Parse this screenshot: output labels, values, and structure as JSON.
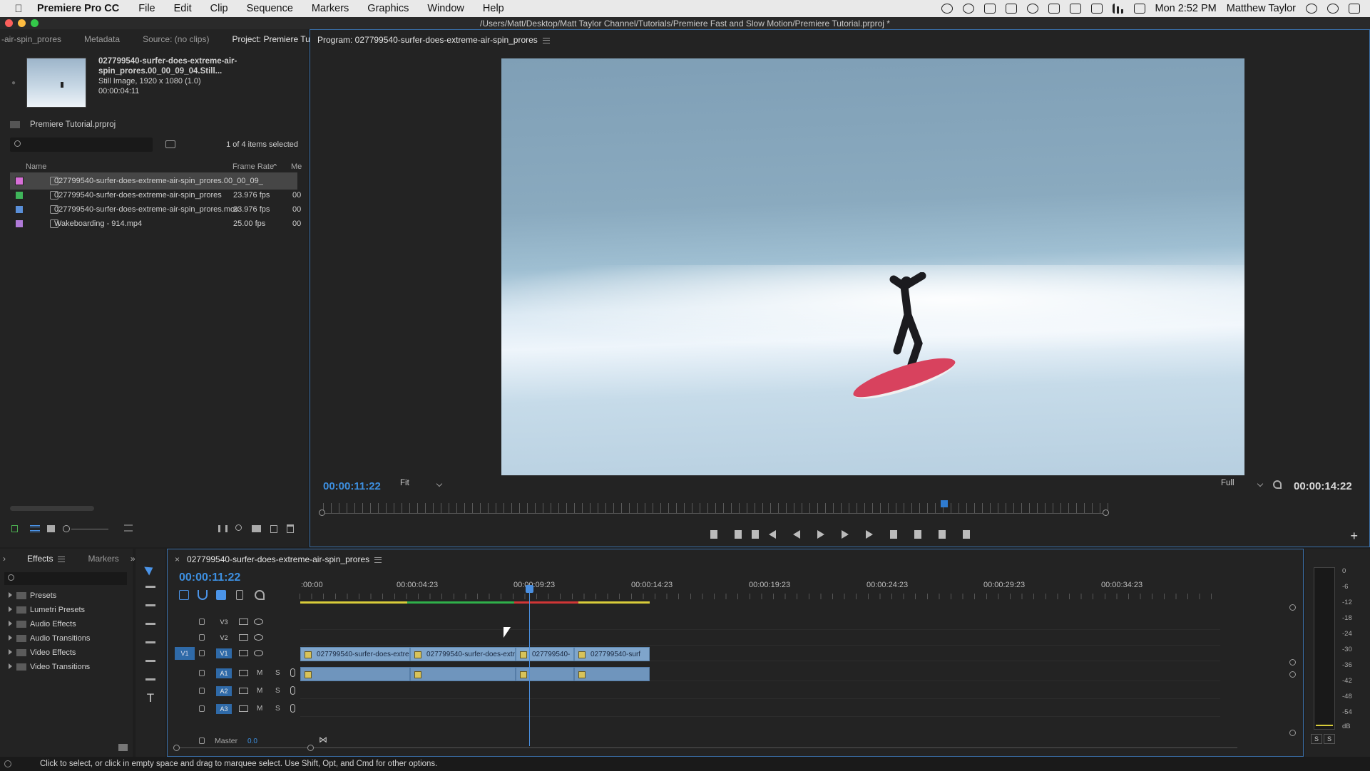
{
  "menubar": {
    "app_name": "Premiere Pro CC",
    "items": [
      "File",
      "Edit",
      "Clip",
      "Sequence",
      "Markers",
      "Graphics",
      "Window",
      "Help"
    ],
    "clock": "Mon 2:52 PM",
    "user": "Matthew Taylor"
  },
  "window": {
    "title": "/Users/Matt/Desktop/Matt Taylor Channel/Tutorials/Premiere Fast and Slow Motion/Premiere Tutorial.prproj *"
  },
  "project_panel": {
    "tabs": [
      "-air-spin_prores",
      "Metadata",
      "Source: (no clips)",
      "Project: Premiere Tutorial"
    ],
    "active_tab": "Project: Premiere Tutorial",
    "preview": {
      "filename": "027799540-surfer-does-extreme-air-spin_prores.00_00_09_04.Still...",
      "description": "Still Image, 1920 x 1080 (1.0)",
      "duration": "00:00:04:11"
    },
    "project_file": "Premiere Tutorial.prproj",
    "search_placeholder": "",
    "selection_count": "1 of 4 items selected",
    "columns": {
      "name": "Name",
      "frame_rate": "Frame Rate",
      "media": "Me"
    },
    "files": [
      {
        "name": "027799540-surfer-does-extreme-air-spin_prores.00_00_09_",
        "frame_rate": "",
        "media": "",
        "color": "#d86fd8",
        "selected": true
      },
      {
        "name": "027799540-surfer-does-extreme-air-spin_prores",
        "frame_rate": "23.976 fps",
        "media": "00",
        "color": "#3fb55a",
        "selected": false
      },
      {
        "name": "027799540-surfer-does-extreme-air-spin_prores.mov",
        "frame_rate": "23.976 fps",
        "media": "00",
        "color": "#5a8fd8",
        "selected": false
      },
      {
        "name": "Wakeboarding - 914.mp4",
        "frame_rate": "25.00 fps",
        "media": "00",
        "color": "#b07ad8",
        "selected": false
      }
    ]
  },
  "program_monitor": {
    "title": "Program: 027799540-surfer-does-extreme-air-spin_prores",
    "current_timecode": "00:00:11:22",
    "fit_value": "Fit",
    "quality_value": "Full",
    "duration_timecode": "00:00:14:22",
    "playhead_fraction": 0.795
  },
  "effects_panel": {
    "tabs": [
      "Effects",
      "Markers"
    ],
    "folders": [
      "Presets",
      "Lumetri Presets",
      "Audio Effects",
      "Audio Transitions",
      "Video Effects",
      "Video Transitions"
    ]
  },
  "timeline": {
    "sequence_name": "027799540-surfer-does-extreme-air-spin_prores",
    "timecode": "00:00:11:22",
    "ruler_labels": [
      ":00:00",
      "00:00:04:23",
      "00:00:09:23",
      "00:00:14:23",
      "00:00:19:23",
      "00:00:24:23",
      "00:00:29:23",
      "00:00:34:23"
    ],
    "video_tracks": [
      "V3",
      "V2",
      "V1"
    ],
    "audio_tracks": [
      "A1",
      "A2",
      "A3"
    ],
    "source_patch_video": "V1",
    "source_patch_audio": "A1",
    "clips": [
      "027799540-surfer-does-extre",
      "027799540-surfer-does-extr",
      "027799540-",
      "027799540-surf"
    ],
    "mute_label": "M",
    "solo_label": "S",
    "master_label": "Master",
    "master_value": "0.0"
  },
  "meters": {
    "db_labels": [
      "0",
      "-6",
      "-12",
      "-18",
      "-24",
      "-30",
      "-36",
      "-42",
      "-48",
      "-54",
      "dB"
    ],
    "solo_left": "S",
    "solo_right": "S"
  },
  "status_bar": {
    "message": "Click to select, or click in empty space and drag to marquee select. Use Shift, Opt, and Cmd for other options."
  }
}
